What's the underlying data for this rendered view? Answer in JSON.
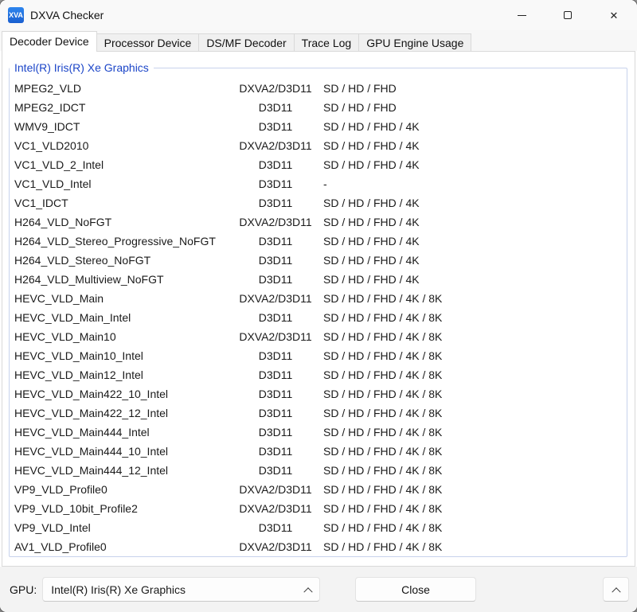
{
  "window": {
    "title": "DXVA Checker",
    "icon_text": "XVA",
    "controls": {
      "minimize": "minimize",
      "maximize": "maximize",
      "close_glyph": "✕"
    }
  },
  "tabs": [
    {
      "label": "Decoder Device",
      "selected": true
    },
    {
      "label": "Processor Device",
      "selected": false
    },
    {
      "label": "DS/MF Decoder",
      "selected": false
    },
    {
      "label": "Trace Log",
      "selected": false
    },
    {
      "label": "GPU Engine Usage",
      "selected": false
    }
  ],
  "group": {
    "title": "Intel(R) Iris(R) Xe Graphics"
  },
  "decoders": [
    {
      "name": "MPEG2_VLD",
      "api": "DXVA2/D3D11",
      "res": "SD / HD / FHD"
    },
    {
      "name": "MPEG2_IDCT",
      "api": "D3D11",
      "res": "SD / HD / FHD"
    },
    {
      "name": "WMV9_IDCT",
      "api": "D3D11",
      "res": "SD / HD / FHD / 4K"
    },
    {
      "name": "VC1_VLD2010",
      "api": "DXVA2/D3D11",
      "res": "SD / HD / FHD / 4K"
    },
    {
      "name": "VC1_VLD_2_Intel",
      "api": "D3D11",
      "res": "SD / HD / FHD / 4K"
    },
    {
      "name": "VC1_VLD_Intel",
      "api": "D3D11",
      "res": "-"
    },
    {
      "name": "VC1_IDCT",
      "api": "D3D11",
      "res": "SD / HD / FHD / 4K"
    },
    {
      "name": "H264_VLD_NoFGT",
      "api": "DXVA2/D3D11",
      "res": "SD / HD / FHD / 4K"
    },
    {
      "name": "H264_VLD_Stereo_Progressive_NoFGT",
      "api": "D3D11",
      "res": "SD / HD / FHD / 4K"
    },
    {
      "name": "H264_VLD_Stereo_NoFGT",
      "api": "D3D11",
      "res": "SD / HD / FHD / 4K"
    },
    {
      "name": "H264_VLD_Multiview_NoFGT",
      "api": "D3D11",
      "res": "SD / HD / FHD / 4K"
    },
    {
      "name": "HEVC_VLD_Main",
      "api": "DXVA2/D3D11",
      "res": "SD / HD / FHD / 4K / 8K"
    },
    {
      "name": "HEVC_VLD_Main_Intel",
      "api": "D3D11",
      "res": "SD / HD / FHD / 4K / 8K"
    },
    {
      "name": "HEVC_VLD_Main10",
      "api": "DXVA2/D3D11",
      "res": "SD / HD / FHD / 4K / 8K"
    },
    {
      "name": "HEVC_VLD_Main10_Intel",
      "api": "D3D11",
      "res": "SD / HD / FHD / 4K / 8K"
    },
    {
      "name": "HEVC_VLD_Main12_Intel",
      "api": "D3D11",
      "res": "SD / HD / FHD / 4K / 8K"
    },
    {
      "name": "HEVC_VLD_Main422_10_Intel",
      "api": "D3D11",
      "res": "SD / HD / FHD / 4K / 8K"
    },
    {
      "name": "HEVC_VLD_Main422_12_Intel",
      "api": "D3D11",
      "res": "SD / HD / FHD / 4K / 8K"
    },
    {
      "name": "HEVC_VLD_Main444_Intel",
      "api": "D3D11",
      "res": "SD / HD / FHD / 4K / 8K"
    },
    {
      "name": "HEVC_VLD_Main444_10_Intel",
      "api": "D3D11",
      "res": "SD / HD / FHD / 4K / 8K"
    },
    {
      "name": "HEVC_VLD_Main444_12_Intel",
      "api": "D3D11",
      "res": "SD / HD / FHD / 4K / 8K"
    },
    {
      "name": "VP9_VLD_Profile0",
      "api": "DXVA2/D3D11",
      "res": "SD / HD / FHD / 4K / 8K"
    },
    {
      "name": "VP9_VLD_10bit_Profile2",
      "api": "DXVA2/D3D11",
      "res": "SD / HD / FHD / 4K / 8K"
    },
    {
      "name": "VP9_VLD_Intel",
      "api": "D3D11",
      "res": "SD / HD / FHD / 4K / 8K"
    },
    {
      "name": "AV1_VLD_Profile0",
      "api": "DXVA2/D3D11",
      "res": "SD / HD / FHD / 4K / 8K"
    }
  ],
  "footer": {
    "gpu_label": "GPU:",
    "gpu_value": "Intel(R) Iris(R) Xe Graphics",
    "close_label": "Close"
  },
  "colors": {
    "group_title": "#1b45c8",
    "group_border": "#c7d2ec",
    "icon_bg": "#1f6ce0"
  }
}
